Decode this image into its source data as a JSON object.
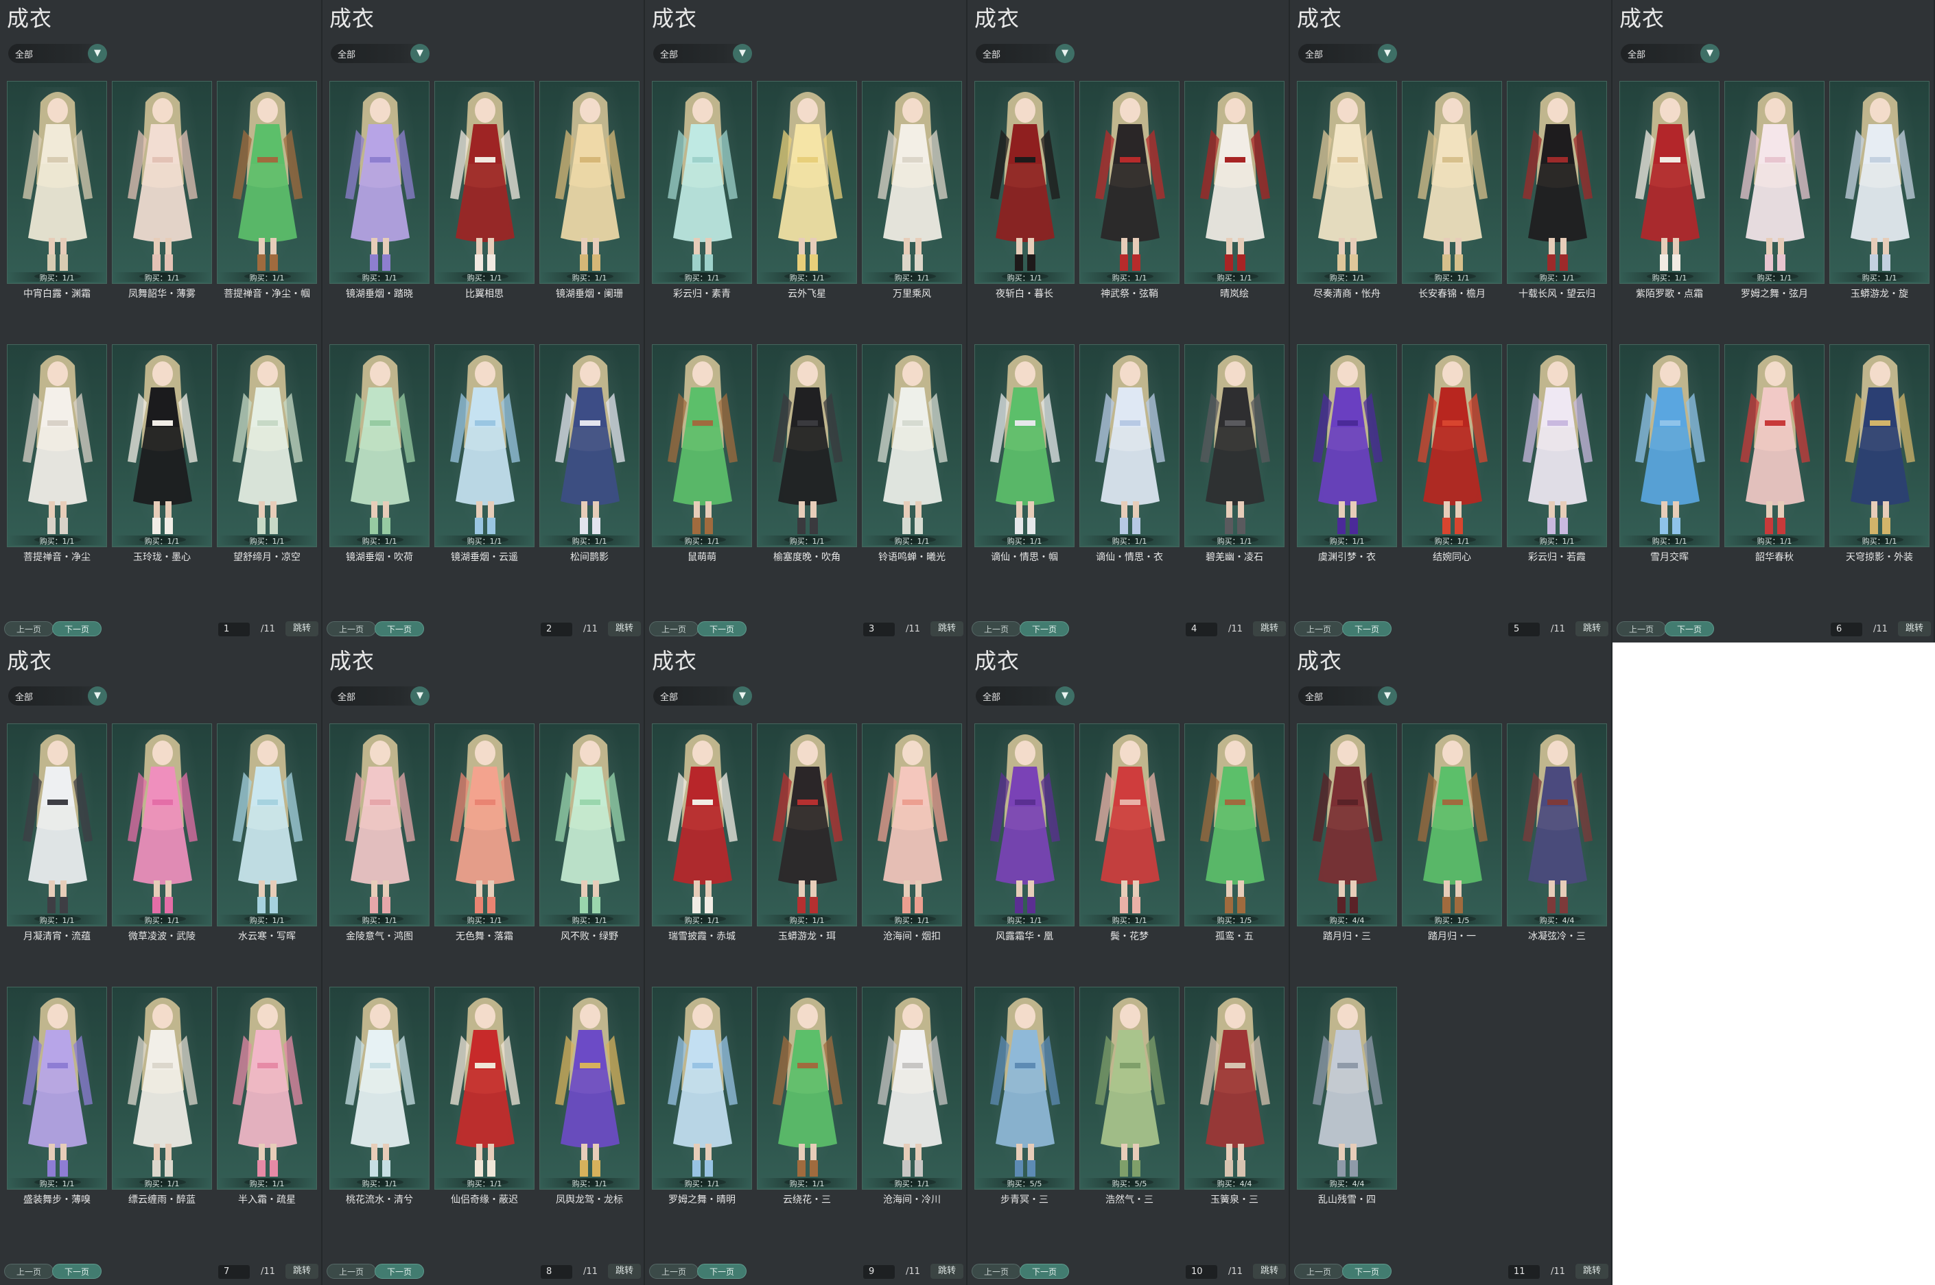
{
  "panel_title": "成衣",
  "filter_label": "全部",
  "prev_label": "上一页",
  "next_label": "下一页",
  "jump_label": "跳转",
  "page_total": "/11",
  "colors": {
    "panel_bg": "#2f3336",
    "card_bg": "#2b5148",
    "accent": "#427c70"
  },
  "icons": {
    "dropdown": "chevron-down-icon"
  },
  "pages": [
    {
      "page": "1",
      "items": [
        {
          "name": "中宵白露・渊霜",
          "buy": "购买：1/1",
          "colors": [
            "#f1ead8",
            "#d8ccb2"
          ]
        },
        {
          "name": "凤舞韶华・薄雾",
          "buy": "购买：1/1",
          "colors": [
            "#f2ddd2",
            "#e3c2b5"
          ]
        },
        {
          "name": "菩提禅音・净尘・帼",
          "buy": "购买：1/1",
          "colors": [
            "#5cbf6a",
            "#a06b3e"
          ]
        },
        {
          "name": "菩提禅音・净尘",
          "buy": "购买：1/1",
          "colors": [
            "#f4f0ea",
            "#d9d2c8"
          ]
        },
        {
          "name": "玉玲珑・墨心",
          "buy": "购买：1/1",
          "colors": [
            "#1b1b1d",
            "#f1ede6"
          ]
        },
        {
          "name": "望舒缔月・凉空",
          "buy": "购买：1/1",
          "colors": [
            "#e6efe4",
            "#c7d9c6"
          ]
        }
      ]
    },
    {
      "page": "2",
      "items": [
        {
          "name": "镜湖垂烟・踏晓",
          "buy": "购买：1/1",
          "colors": [
            "#b7a4e6",
            "#8e7fcf"
          ]
        },
        {
          "name": "比翼相思",
          "buy": "购买：1/1",
          "colors": [
            "#9e2424",
            "#f1e9e0"
          ]
        },
        {
          "name": "镜湖垂烟・阑珊",
          "buy": "购买：1/1",
          "colors": [
            "#efd9a8",
            "#d6b777"
          ]
        },
        {
          "name": "镜湖垂烟・吹荷",
          "buy": "购买：1/1",
          "colors": [
            "#bfe3c7",
            "#97cba2"
          ]
        },
        {
          "name": "镜湖垂烟・云遥",
          "buy": "购买：1/1",
          "colors": [
            "#c6e2f1",
            "#9ac6e2"
          ]
        },
        {
          "name": "松间鹊影",
          "buy": "购买：1/1",
          "colors": [
            "#3d4d86",
            "#e3e4ee"
          ]
        }
      ]
    },
    {
      "page": "3",
      "items": [
        {
          "name": "彩云归・素青",
          "buy": "购买：1/1",
          "colors": [
            "#bfe9e3",
            "#9ed2cb"
          ]
        },
        {
          "name": "云外飞星",
          "buy": "购买：1/1",
          "colors": [
            "#f5e4a6",
            "#e8cf7a"
          ]
        },
        {
          "name": "万里乘风",
          "buy": "购买：1/1",
          "colors": [
            "#f3efe6",
            "#dcd6c9"
          ]
        },
        {
          "name": "鼠萌萌",
          "buy": "购买：1/1",
          "colors": [
            "#5cbf6a",
            "#a06b3e"
          ]
        },
        {
          "name": "榆塞度晚・吹角",
          "buy": "购买：1/1",
          "colors": [
            "#202022",
            "#3a3a3e"
          ]
        },
        {
          "name": "铃语鸣蝉・曦光",
          "buy": "购买：1/1",
          "colors": [
            "#eef0ea",
            "#d6dbd1"
          ]
        }
      ]
    },
    {
      "page": "4",
      "items": [
        {
          "name": "夜斩白・暮长",
          "buy": "购买：1/1",
          "colors": [
            "#8f1f1f",
            "#1e1a1a"
          ]
        },
        {
          "name": "神武祭・弦鞘",
          "buy": "购买：1/1",
          "colors": [
            "#2a2627",
            "#b72b2b"
          ]
        },
        {
          "name": "晴岚绘",
          "buy": "购买：1/1",
          "colors": [
            "#f2ede6",
            "#a82424"
          ]
        },
        {
          "name": "谪仙・情思・帼",
          "buy": "购买：1/1",
          "colors": [
            "#5cbf6a",
            "#e5e8ea"
          ]
        },
        {
          "name": "谪仙・情思・衣",
          "buy": "购买：1/1",
          "colors": [
            "#dfe8f4",
            "#b7c9e4"
          ]
        },
        {
          "name": "碧羌幽・凌石",
          "buy": "购买：1/1",
          "colors": [
            "#2e2e30",
            "#5a5a5e"
          ]
        }
      ]
    },
    {
      "page": "5",
      "items": [
        {
          "name": "尽奏清商・怅舟",
          "buy": "购买：1/1",
          "colors": [
            "#f3e6c8",
            "#dfc79a"
          ]
        },
        {
          "name": "长安春锦・檐月",
          "buy": "购买：1/1",
          "colors": [
            "#f2e2bf",
            "#d7c08c"
          ]
        },
        {
          "name": "十载长风・望云归",
          "buy": "购买：1/1",
          "colors": [
            "#1e1c1e",
            "#9d2a2a"
          ]
        },
        {
          "name": "虞渊引梦・衣",
          "buy": "购买：1/1",
          "colors": [
            "#6a3fc1",
            "#4b2a99"
          ]
        },
        {
          "name": "结婉同心",
          "buy": "购买：1/1",
          "colors": [
            "#b8261f",
            "#d8452f"
          ]
        },
        {
          "name": "彩云归・若霞",
          "buy": "购买：1/1",
          "colors": [
            "#efe8f3",
            "#c9b9df"
          ]
        }
      ]
    },
    {
      "page": "6",
      "items": [
        {
          "name": "紫陌罗歌・点霜",
          "buy": "购买：1/1",
          "colors": [
            "#b3262a",
            "#f1ebe3"
          ]
        },
        {
          "name": "罗姆之舞・弦月",
          "buy": "购买：1/1",
          "colors": [
            "#f5e6ea",
            "#e8c5cf"
          ]
        },
        {
          "name": "玉蟒游龙・旋",
          "buy": "购买：1/1",
          "colors": [
            "#e7edf3",
            "#c4d1e0"
          ]
        },
        {
          "name": "雪月交晖",
          "buy": "购买：1/1",
          "colors": [
            "#5aa6e0",
            "#8fc3ea"
          ]
        },
        {
          "name": "韶华春秋",
          "buy": "购买：1/1",
          "colors": [
            "#f1c9c6",
            "#c83a3a"
          ]
        },
        {
          "name": "天穹掠影・外装",
          "buy": "购买：1/1",
          "colors": [
            "#2b3f73",
            "#d2b46a"
          ]
        }
      ]
    },
    {
      "page": "7",
      "items": [
        {
          "name": "月凝清宵・流蕴",
          "buy": "购买：1/1",
          "colors": [
            "#eef0f2",
            "#3e3e44"
          ]
        },
        {
          "name": "微草凌波・武陵",
          "buy": "购买：1/1",
          "colors": [
            "#ef8fbd",
            "#e46ea7"
          ]
        },
        {
          "name": "水云寒・写晖",
          "buy": "购买：1/1",
          "colors": [
            "#cbe7ef",
            "#a6d2df"
          ]
        },
        {
          "name": "盛装舞步・薄嗅",
          "buy": "购买：1/1",
          "colors": [
            "#b7a5e8",
            "#8e7dd4"
          ]
        },
        {
          "name": "缥云缠雨・醉蓝",
          "buy": "购买：1/1",
          "colors": [
            "#f2efe8",
            "#dcd7cc"
          ]
        },
        {
          "name": "半入霜・疏星",
          "buy": "购买：1/1",
          "colors": [
            "#f2b7c8",
            "#e68aa6"
          ]
        }
      ]
    },
    {
      "page": "8",
      "items": [
        {
          "name": "金陵意气・鸿图",
          "buy": "购买：1/1",
          "colors": [
            "#f1c7c8",
            "#e6a7aa"
          ]
        },
        {
          "name": "无色舞・落霜",
          "buy": "购买：1/1",
          "colors": [
            "#f3a38e",
            "#e98472"
          ]
        },
        {
          "name": "风不败・绿野",
          "buy": "购买：1/1",
          "colors": [
            "#c5ecd2",
            "#9ad6ad"
          ]
        },
        {
          "name": "桃花流水・清兮",
          "buy": "购买：1/1",
          "colors": [
            "#e7f2f4",
            "#c7dfe4"
          ]
        },
        {
          "name": "仙侣奇缘・蔽迟",
          "buy": "购买：1/1",
          "colors": [
            "#c72a2a",
            "#f0e6d8"
          ]
        },
        {
          "name": "凤舆龙驾・龙标",
          "buy": "购买：1/1",
          "colors": [
            "#6c4bc6",
            "#d7b15c"
          ]
        }
      ]
    },
    {
      "page": "9",
      "items": [
        {
          "name": "瑞雪披霞・赤城",
          "buy": "购买：1/1",
          "colors": [
            "#b8262a",
            "#f1ece4"
          ]
        },
        {
          "name": "玉蟒游龙・珥",
          "buy": "购买：1/1",
          "colors": [
            "#2b2628",
            "#b53030"
          ]
        },
        {
          "name": "沧海间・烟扣",
          "buy": "购买：1/1",
          "colors": [
            "#f4c7bd",
            "#ec9f90"
          ]
        },
        {
          "name": "罗姆之舞・晴明",
          "buy": "购买：1/1",
          "colors": [
            "#c3dff2",
            "#98c3e4"
          ]
        },
        {
          "name": "云绕花・三",
          "buy": "购买：1/1",
          "colors": [
            "#5cbf6a",
            "#a06b3e"
          ]
        },
        {
          "name": "沧海间・冷川",
          "buy": "购买：1/1",
          "colors": [
            "#f1f0ef",
            "#c8c6c4"
          ]
        }
      ]
    },
    {
      "page": "10",
      "items": [
        {
          "name": "风露霜华・凰",
          "buy": "购买：1/1",
          "colors": [
            "#7a42b6",
            "#5b2f92"
          ]
        },
        {
          "name": "鬓・花梦",
          "buy": "购买：1/1",
          "colors": [
            "#cf3d3d",
            "#e9b1a7"
          ]
        },
        {
          "name": "孤鸾・五",
          "buy": "购买：1/5",
          "colors": [
            "#5cbf6a",
            "#a06b3e"
          ]
        },
        {
          "name": "步青冥・三",
          "buy": "购买：5/5",
          "colors": [
            "#8fb9d8",
            "#5d8bb4"
          ]
        },
        {
          "name": "浩然气・三",
          "buy": "购买：5/5",
          "colors": [
            "#a9c48c",
            "#7f9f6a"
          ]
        },
        {
          "name": "玉簧泉・三",
          "buy": "购买：4/4",
          "colors": [
            "#9e3535",
            "#d7c3b0"
          ]
        }
      ]
    },
    {
      "page": "11",
      "items": [
        {
          "name": "踏月归・三",
          "buy": "购买：4/4",
          "colors": [
            "#7b2f33",
            "#5a2227"
          ]
        },
        {
          "name": "踏月归・一",
          "buy": "购买：1/5",
          "colors": [
            "#5cbf6a",
            "#a06b3e"
          ]
        },
        {
          "name": "冰凝弦冷・三",
          "buy": "购买：4/4",
          "colors": [
            "#4b4a7e",
            "#7d3a3a"
          ]
        },
        {
          "name": "乱山残雪・四",
          "buy": "购买：4/4",
          "colors": [
            "#c4cbd6",
            "#8f9aa9"
          ]
        }
      ]
    }
  ]
}
